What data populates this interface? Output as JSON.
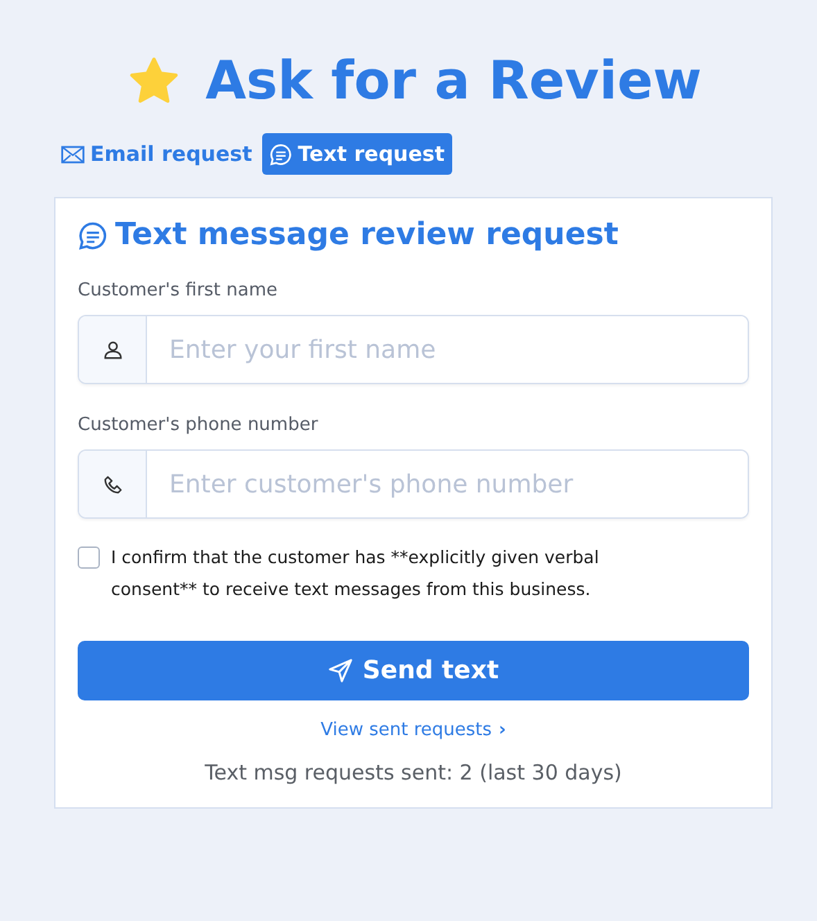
{
  "title": "Ask for a Review",
  "tabs": [
    {
      "label": "Email request",
      "kind": "email",
      "selected": false
    },
    {
      "label": "Text request",
      "kind": "text",
      "selected": true
    }
  ],
  "card": {
    "heading": "Text message review request",
    "fields": [
      {
        "label": "Customer's first name",
        "kind": "person",
        "placeholder": "Enter your first name"
      },
      {
        "label": "Customer's phone number",
        "kind": "phone",
        "placeholder": "Enter customer's phone number"
      }
    ],
    "consent": {
      "label": "I confirm that the customer has **explicitly given verbal consent** to receive text messages from this business.",
      "checked": false
    },
    "send_button": "Send text",
    "view_link": "View sent requests",
    "link_arrow": "›",
    "stats": "Text msg requests sent: 2 (last 30 days)"
  }
}
